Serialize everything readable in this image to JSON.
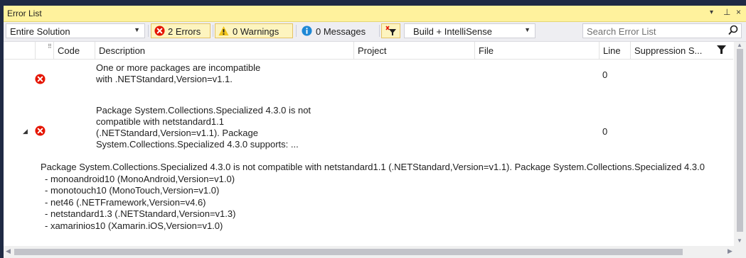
{
  "panel": {
    "title": "Error List",
    "dropdown_icon": "▾",
    "pin_icon": "⊥",
    "close_icon": "×"
  },
  "toolbar": {
    "scope": "Entire Solution",
    "errors": "2 Errors",
    "warnings": "0 Warnings",
    "messages": "0 Messages",
    "build_filter": "Build + IntelliSense",
    "search_placeholder": "Search Error List"
  },
  "columns": {
    "code": "Code",
    "description": "Description",
    "project": "Project",
    "file": "File",
    "line": "Line",
    "suppression": "Suppression S..."
  },
  "rows": [
    {
      "desc": [
        "One or more packages are incompatible",
        "with .NETStandard,Version=v1.1."
      ],
      "line": "0"
    },
    {
      "desc": [
        "Package System.Collections.Specialized 4.3.0 is not",
        "compatible with netstandard1.1",
        "(.NETStandard,Version=v1.1). Package",
        "System.Collections.Specialized 4.3.0 supports: ..."
      ],
      "line": "0"
    }
  ],
  "detail": {
    "lead": "Package System.Collections.Specialized 4.3.0 is not compatible with netstandard1.1 (.NETStandard,Version=v1.1). Package System.Collections.Specialized 4.3.0",
    "items": [
      "- monoandroid10 (MonoAndroid,Version=v1.0)",
      "- monotouch10 (MonoTouch,Version=v1.0)",
      "- net46 (.NETFramework,Version=v4.6)",
      "- netstandard1.3 (.NETStandard,Version=v1.3)",
      "- xamarinios10 (Xamarin.iOS,Version=v1.0)"
    ]
  },
  "colors": {
    "title_bar": "#fff29d",
    "error_red": "#e51400",
    "warning_yellow": "#f2c51c",
    "info_blue": "#1e88d6",
    "active_filter": "#fdf4bf"
  }
}
